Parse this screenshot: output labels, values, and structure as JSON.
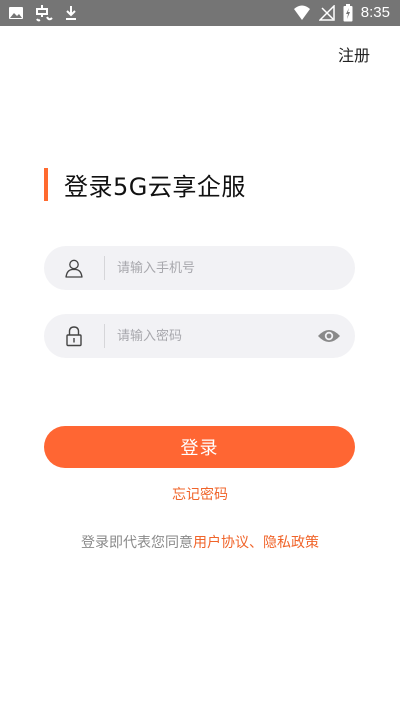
{
  "status_bar": {
    "time": "8:35",
    "icons_left": [
      "image-icon",
      "notification-app-icon",
      "download-icon"
    ],
    "icons_right": [
      "wifi-icon",
      "no-signal-icon",
      "battery-charging-icon"
    ]
  },
  "header": {
    "register_label": "注册"
  },
  "title": {
    "text": "登录5G云享企服",
    "accent_color": "#ff6a2f"
  },
  "form": {
    "phone": {
      "placeholder": "请输入手机号",
      "value": "",
      "icon": "user-icon"
    },
    "password": {
      "placeholder": "请输入密码",
      "value": "",
      "icon": "lock-icon",
      "toggle_icon": "eye-icon"
    }
  },
  "actions": {
    "login_label": "登录",
    "forgot_label": "忘记密码"
  },
  "agreement": {
    "prefix": "登录即代表您同意",
    "user_agreement": "用户协议",
    "separator": "、",
    "privacy_policy": "隐私政策"
  },
  "colors": {
    "brand": "#ff6633",
    "link": "#f0642a",
    "status_bar": "#757575"
  }
}
